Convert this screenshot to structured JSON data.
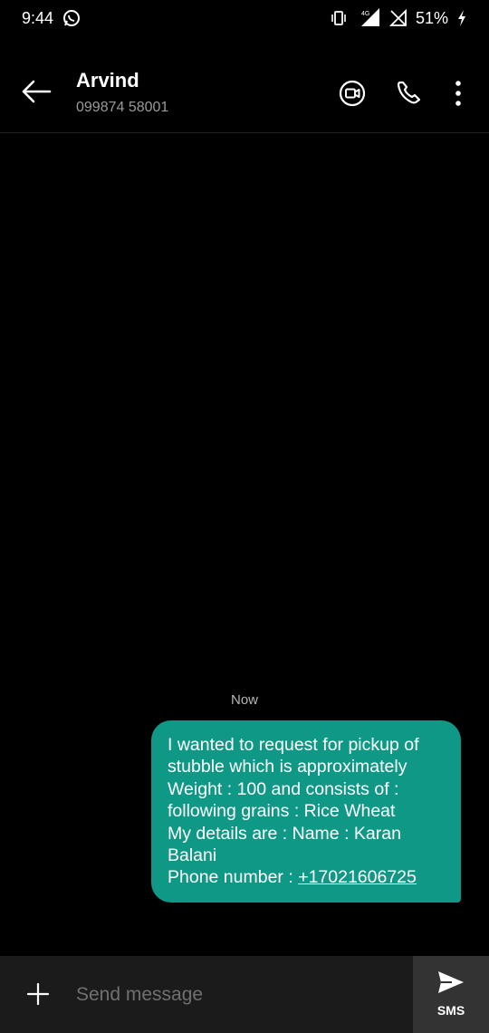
{
  "status_bar": {
    "time": "9:44",
    "network": "4G",
    "battery": "51%"
  },
  "header": {
    "contact_name": "Arvind",
    "contact_number": "099874 58001"
  },
  "conversation": {
    "timestamp": "Now",
    "message": {
      "lines": [
        "I wanted to request for pickup of",
        "stubble which is approximately",
        "Weight : 100 and consists of :",
        "following grains :  Rice  Wheat",
        "My details are : Name : Karan",
        "Balani"
      ],
      "phone_prefix": "Phone number : ",
      "phone_link": "+17021606725"
    }
  },
  "composer": {
    "placeholder": "Send message",
    "send_label": "SMS"
  },
  "colors": {
    "bubble": "#0f9886",
    "background": "#000000",
    "composer": "#1b1b1b"
  }
}
